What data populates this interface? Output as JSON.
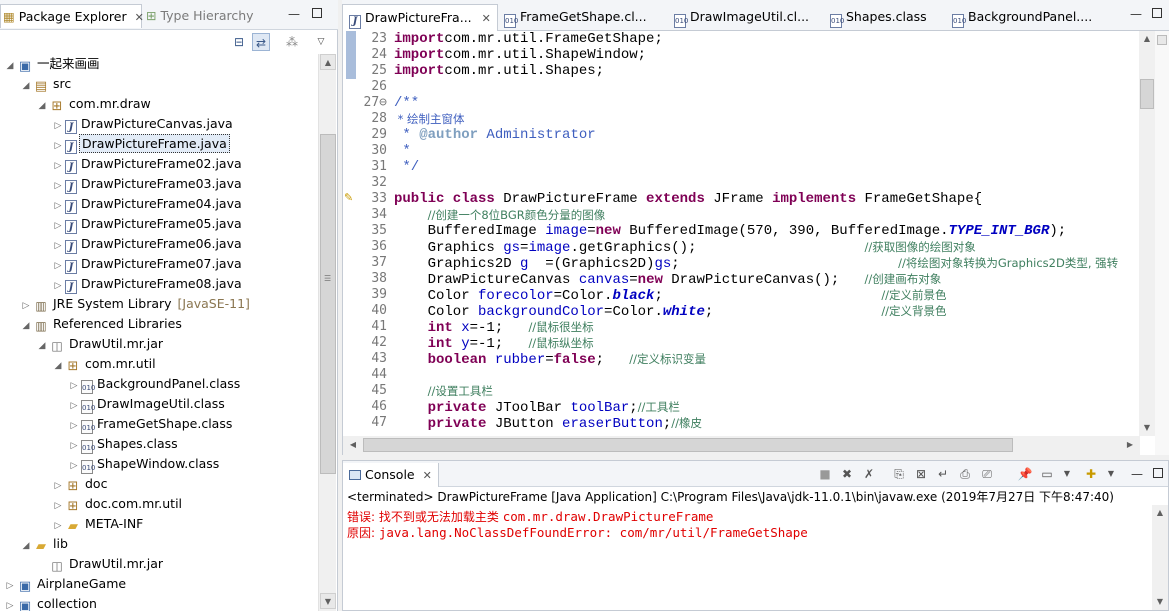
{
  "left_panel": {
    "tabs": [
      {
        "label": "Package Explorer",
        "active": true
      },
      {
        "label": "Type Hierarchy",
        "active": false
      }
    ],
    "tree": [
      {
        "label": "一起来画画",
        "depth": 0,
        "icon": "project",
        "expanded": true
      },
      {
        "label": "src",
        "depth": 1,
        "icon": "source-folder",
        "expanded": true
      },
      {
        "label": "com.mr.draw",
        "depth": 2,
        "icon": "package",
        "expanded": true
      },
      {
        "label": "DrawPictureCanvas.java",
        "depth": 3,
        "icon": "java-file",
        "expanded": false
      },
      {
        "label": "DrawPictureFrame.java",
        "depth": 3,
        "icon": "java-file",
        "expanded": false,
        "selected": true
      },
      {
        "label": "DrawPictureFrame02.java",
        "depth": 3,
        "icon": "java-file",
        "expanded": false
      },
      {
        "label": "DrawPictureFrame03.java",
        "depth": 3,
        "icon": "java-file",
        "expanded": false
      },
      {
        "label": "DrawPictureFrame04.java",
        "depth": 3,
        "icon": "java-file",
        "expanded": false
      },
      {
        "label": "DrawPictureFrame05.java",
        "depth": 3,
        "icon": "java-file",
        "expanded": false
      },
      {
        "label": "DrawPictureFrame06.java",
        "depth": 3,
        "icon": "java-file",
        "expanded": false
      },
      {
        "label": "DrawPictureFrame07.java",
        "depth": 3,
        "icon": "java-file",
        "expanded": false
      },
      {
        "label": "DrawPictureFrame08.java",
        "depth": 3,
        "icon": "java-file",
        "expanded": false
      },
      {
        "label": "JRE System Library",
        "suffix": "[JavaSE-11]",
        "depth": 1,
        "icon": "library",
        "expanded": false
      },
      {
        "label": "Referenced Libraries",
        "depth": 1,
        "icon": "library",
        "expanded": true
      },
      {
        "label": "DrawUtil.mr.jar",
        "depth": 2,
        "icon": "jar",
        "expanded": true
      },
      {
        "label": "com.mr.util",
        "depth": 3,
        "icon": "package",
        "expanded": true
      },
      {
        "label": "BackgroundPanel.class",
        "depth": 4,
        "icon": "class-file",
        "expanded": false
      },
      {
        "label": "DrawImageUtil.class",
        "depth": 4,
        "icon": "class-file",
        "expanded": false
      },
      {
        "label": "FrameGetShape.class",
        "depth": 4,
        "icon": "class-file",
        "expanded": false
      },
      {
        "label": "Shapes.class",
        "depth": 4,
        "icon": "class-file",
        "expanded": false
      },
      {
        "label": "ShapeWindow.class",
        "depth": 4,
        "icon": "class-file",
        "expanded": false
      },
      {
        "label": "doc",
        "depth": 3,
        "icon": "package",
        "expanded": false
      },
      {
        "label": "doc.com.mr.util",
        "depth": 3,
        "icon": "package",
        "expanded": false
      },
      {
        "label": "META-INF",
        "depth": 3,
        "icon": "folder",
        "expanded": false
      },
      {
        "label": "lib",
        "depth": 1,
        "icon": "folder",
        "expanded": true
      },
      {
        "label": "DrawUtil.mr.jar",
        "depth": 2,
        "icon": "jar",
        "expanded": null
      },
      {
        "label": "AirplaneGame",
        "depth": 0,
        "icon": "project",
        "expanded": false
      },
      {
        "label": "collection",
        "depth": 0,
        "icon": "project",
        "expanded": false
      }
    ]
  },
  "editor": {
    "tabs": [
      {
        "label": "DrawPictureFra...",
        "active": true,
        "icon": "java-file"
      },
      {
        "label": "FrameGetShape.cl...",
        "active": false,
        "icon": "class-file"
      },
      {
        "label": "DrawImageUtil.cl...",
        "active": false,
        "icon": "class-file"
      },
      {
        "label": "Shapes.class",
        "active": false,
        "icon": "class-file"
      },
      {
        "label": "BackgroundPanel....",
        "active": false,
        "icon": "class-file"
      }
    ],
    "line_numbers": [
      "23",
      "24",
      "25",
      "26",
      "27⊖",
      "28",
      "29",
      "30",
      "31",
      "32",
      "33",
      "34",
      "35",
      "36",
      "37",
      "38",
      "39",
      "40",
      "41",
      "42",
      "43",
      "44",
      "45",
      "46",
      "47"
    ],
    "code_lines": [
      [
        [
          "kw",
          "import"
        ],
        [
          "",
          "com.mr.util.FrameGetShape;"
        ]
      ],
      [
        [
          "kw",
          "import"
        ],
        [
          "",
          "com.mr.util.ShapeWindow;"
        ]
      ],
      [
        [
          "kw",
          "import"
        ],
        [
          "",
          "com.mr.util.Shapes;"
        ]
      ],
      [],
      [
        [
          "jd",
          "/**"
        ]
      ],
      [
        [
          "jd",
          " * 绘制主窗体"
        ]
      ],
      [
        [
          "jd",
          " * "
        ],
        [
          "jt",
          "@author"
        ],
        [
          "jd",
          " Administrator"
        ]
      ],
      [
        [
          "jd",
          " *"
        ]
      ],
      [
        [
          "jd",
          " */"
        ]
      ],
      [],
      [
        [
          "kw",
          "public class "
        ],
        [
          "",
          "DrawPictureFrame "
        ],
        [
          "kw",
          "extends "
        ],
        [
          "",
          "JFrame "
        ],
        [
          "kw",
          "implements "
        ],
        [
          "",
          "FrameGetShape{"
        ]
      ],
      [
        [
          "",
          "    "
        ],
        [
          "cm",
          "//创建一个8位BGR颜色分量的图像"
        ]
      ],
      [
        [
          "",
          "    BufferedImage "
        ],
        [
          "fd",
          "image"
        ],
        [
          "",
          "="
        ],
        [
          "kw",
          "new "
        ],
        [
          "",
          "BufferedImage(570, 390, BufferedImage."
        ],
        [
          "sf",
          "TYPE_INT_BGR"
        ],
        [
          "",
          ");"
        ]
      ],
      [
        [
          "",
          "    Graphics "
        ],
        [
          "fd",
          "gs"
        ],
        [
          "",
          "="
        ],
        [
          "fd",
          "image"
        ],
        [
          "",
          ".getGraphics();                    "
        ],
        [
          "cm",
          "//获取图像的绘图对象"
        ]
      ],
      [
        [
          "",
          "    Graphics2D "
        ],
        [
          "fd",
          "g"
        ],
        [
          "",
          "  =(Graphics2D)"
        ],
        [
          "fd",
          "gs"
        ],
        [
          "",
          ";                          "
        ],
        [
          "cm",
          "//将绘图对象转换为Graphics2D类型, 强转"
        ]
      ],
      [
        [
          "",
          "    DrawPictureCanvas "
        ],
        [
          "fd",
          "canvas"
        ],
        [
          "",
          "="
        ],
        [
          "kw",
          "new "
        ],
        [
          "",
          "DrawPictureCanvas();   "
        ],
        [
          "cm",
          "//创建画布对象"
        ]
      ],
      [
        [
          "",
          "    Color "
        ],
        [
          "fd",
          "forecolor"
        ],
        [
          "",
          "=Color."
        ],
        [
          "sf",
          "black"
        ],
        [
          "",
          ";                          "
        ],
        [
          "cm",
          "//定义前景色"
        ]
      ],
      [
        [
          "",
          "    Color "
        ],
        [
          "fd",
          "backgroundColor"
        ],
        [
          "",
          "=Color."
        ],
        [
          "sf",
          "white"
        ],
        [
          "",
          ";                    "
        ],
        [
          "cm",
          "//定义背景色"
        ]
      ],
      [
        [
          "",
          "    "
        ],
        [
          "kw",
          "int "
        ],
        [
          "fd",
          "x"
        ],
        [
          "",
          "=-1;   "
        ],
        [
          "cm",
          "//鼠标很坐标"
        ]
      ],
      [
        [
          "",
          "    "
        ],
        [
          "kw",
          "int "
        ],
        [
          "fd",
          "y"
        ],
        [
          "",
          "=-1;   "
        ],
        [
          "cm",
          "//鼠标纵坐标"
        ]
      ],
      [
        [
          "",
          "    "
        ],
        [
          "kw",
          "boolean "
        ],
        [
          "fd",
          "rubber"
        ],
        [
          "",
          "="
        ],
        [
          "kw",
          "false"
        ],
        [
          "",
          ";   "
        ],
        [
          "cm",
          "//定义标识变量"
        ]
      ],
      [],
      [
        [
          "",
          "    "
        ],
        [
          "cm",
          "//设置工具栏"
        ]
      ],
      [
        [
          "",
          "    "
        ],
        [
          "kw",
          "private "
        ],
        [
          "",
          "JToolBar "
        ],
        [
          "fd",
          "toolBar"
        ],
        [
          "",
          ";"
        ],
        [
          "cm",
          "//工具栏"
        ]
      ],
      [
        [
          "",
          "    "
        ],
        [
          "kw",
          "private "
        ],
        [
          "",
          "JButton "
        ],
        [
          "fd",
          "eraserButton"
        ],
        [
          "",
          ";"
        ],
        [
          "cm",
          "//橡皮"
        ]
      ]
    ]
  },
  "console": {
    "tab_label": "Console",
    "status": "<terminated> DrawPictureFrame [Java Application] C:\\Program Files\\Java\\jdk-11.0.1\\bin\\javaw.exe (2019年7月27日 下午8:47:40)",
    "errors": [
      {
        "prefix": "错误: 找不到或无法加载主类 ",
        "text": "com.mr.draw.DrawPictureFrame"
      },
      {
        "prefix": "原因: ",
        "text": "java.lang.NoClassDefFoundError: com/mr/util/FrameGetShape"
      }
    ]
  }
}
